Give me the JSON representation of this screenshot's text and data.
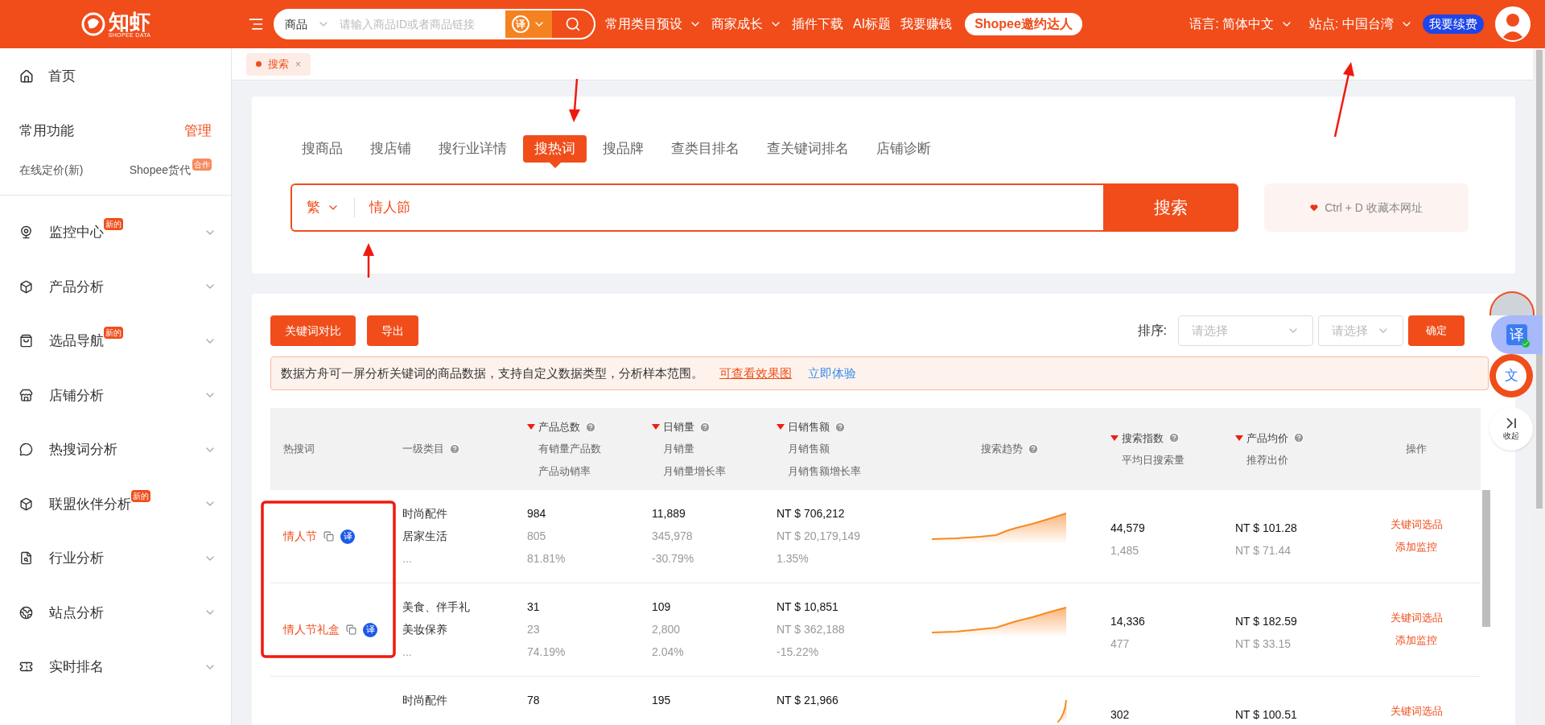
{
  "topbar": {
    "logo": {
      "name": "知虾",
      "tagline": "SHOPEE DATA"
    },
    "search": {
      "scope": "商品",
      "placeholder": "请输入商品ID或者商品链接",
      "translate": "译"
    },
    "nav": [
      {
        "label": "常用类目预设",
        "dropdown": true
      },
      {
        "label": "商家成长",
        "dropdown": true
      },
      {
        "label": "插件下载",
        "dropdown": false
      },
      {
        "label": "AI标题",
        "dropdown": false
      },
      {
        "label": "我要赚钱",
        "dropdown": false
      }
    ],
    "promo": "Shopee邀约达人",
    "language": "语言: 简体中文",
    "site": "站点: 中国台湾",
    "renew": "我要续费"
  },
  "sidebar": {
    "home": "首页",
    "common": {
      "title": "常用功能",
      "manage": "管理",
      "links": [
        {
          "label": "在线定价(新)"
        },
        {
          "label": "Shopee货代",
          "badge": "合作"
        }
      ]
    },
    "items": [
      {
        "label": "监控中心",
        "badge": "新的"
      },
      {
        "label": "产品分析"
      },
      {
        "label": "选品导航",
        "badge": "新的"
      },
      {
        "label": "店铺分析"
      },
      {
        "label": "热搜词分析"
      },
      {
        "label": "联盟伙伴分析",
        "badge": "新的"
      },
      {
        "label": "行业分析"
      },
      {
        "label": "站点分析"
      },
      {
        "label": "实时排名"
      }
    ]
  },
  "open_tabs": [
    {
      "label": "搜索",
      "selected": true,
      "close": "×"
    }
  ],
  "search_tabs": [
    {
      "label": "搜商品",
      "selected": false
    },
    {
      "label": "搜店铺",
      "selected": false
    },
    {
      "label": "搜行业详情",
      "selected": false
    },
    {
      "label": "搜热词",
      "selected": true
    },
    {
      "label": "搜品牌",
      "selected": false
    },
    {
      "label": "查类目排名",
      "selected": false
    },
    {
      "label": "查关键词排名",
      "selected": false
    },
    {
      "label": "店铺诊断",
      "selected": false
    }
  ],
  "search": {
    "script": "繁",
    "value": "情人節",
    "button": "搜索",
    "bookmark": "Ctrl + D 收藏本网址"
  },
  "toolbar": {
    "buttons": [
      "关键词对比",
      "导出"
    ],
    "sort_label": "排序:",
    "selects": [
      {
        "placeholder": "请选择"
      },
      {
        "placeholder": "请选择"
      }
    ],
    "confirm": "确定"
  },
  "notice": {
    "text": "数据方舟可一屏分析关键词的商品数据，支持自定义数据类型，分析样本范围。",
    "links": [
      "可查看效果图",
      "立即体验"
    ]
  },
  "table": {
    "columns": [
      {
        "lines": [
          {
            "text": "热搜词",
            "sorted": false,
            "help": false
          }
        ]
      },
      {
        "lines": [
          {
            "text": "一级类目",
            "sorted": false,
            "help": true
          }
        ]
      },
      {
        "lines": [
          {
            "text": "产品总数",
            "sorted": true,
            "help": true
          },
          {
            "text": "有销量产品数",
            "sorted": false,
            "help": false
          },
          {
            "text": "产品动销率",
            "sorted": false,
            "help": false
          }
        ]
      },
      {
        "lines": [
          {
            "text": "日销量",
            "sorted": true,
            "help": true
          },
          {
            "text": "月销量",
            "sorted": false,
            "help": false
          },
          {
            "text": "月销量增长率",
            "sorted": false,
            "help": false
          }
        ]
      },
      {
        "lines": [
          {
            "text": "日销售额",
            "sorted": true,
            "help": true
          },
          {
            "text": "月销售额",
            "sorted": false,
            "help": false
          },
          {
            "text": "月销售额增长率",
            "sorted": false,
            "help": false
          }
        ]
      },
      {
        "lines": [
          {
            "text": "搜索趋势",
            "sorted": false,
            "help": true
          }
        ]
      },
      {
        "lines": [
          {
            "text": "搜索指数",
            "sorted": true,
            "help": true
          },
          {
            "text": "平均日搜索量",
            "sorted": false,
            "help": false
          }
        ]
      },
      {
        "lines": [
          {
            "text": "产品均价",
            "sorted": true,
            "help": true
          },
          {
            "text": "推荐出价",
            "sorted": false,
            "help": false
          }
        ]
      },
      {
        "lines": [
          {
            "text": "操作",
            "sorted": false,
            "help": false
          }
        ]
      }
    ],
    "rows": [
      {
        "keyword": "情人节",
        "translate": "译",
        "categories": [
          "时尚配件",
          "居家生活",
          "..."
        ],
        "products": [
          "984",
          "805",
          "81.81%"
        ],
        "sales": [
          "11,889",
          "345,978",
          "-30.79%"
        ],
        "revenue": [
          "NT $ 706,212",
          "NT $ 20,179,149",
          "1.35%"
        ],
        "search_index": [
          "44,579",
          "1,485"
        ],
        "price": [
          "NT $ 101.28",
          "NT $ 71.44"
        ],
        "actions": [
          "关键词选品",
          "添加监控"
        ]
      },
      {
        "keyword": "情人节礼盒",
        "translate": "译",
        "categories": [
          "美食、伴手礼",
          "美妆保养",
          "..."
        ],
        "products": [
          "31",
          "23",
          "74.19%"
        ],
        "sales": [
          "109",
          "2,800",
          "2.04%"
        ],
        "revenue": [
          "NT $ 10,851",
          "NT $ 362,188",
          "-15.22%"
        ],
        "search_index": [
          "14,336",
          "477"
        ],
        "price": [
          "NT $ 182.59",
          "NT $ 33.15"
        ],
        "actions": [
          "关键词选品",
          "添加监控"
        ]
      },
      {
        "categories": [
          "时尚配件"
        ],
        "products": [
          "78"
        ],
        "sales": [
          "195"
        ],
        "revenue": [
          "NT $ 21,966"
        ],
        "search_index": [
          "302"
        ],
        "price": [
          "NT $ 100.51"
        ],
        "actions": [
          "关键词选品"
        ]
      }
    ]
  },
  "floating": {
    "translate": "译",
    "text": "文",
    "collapse": "收起"
  }
}
